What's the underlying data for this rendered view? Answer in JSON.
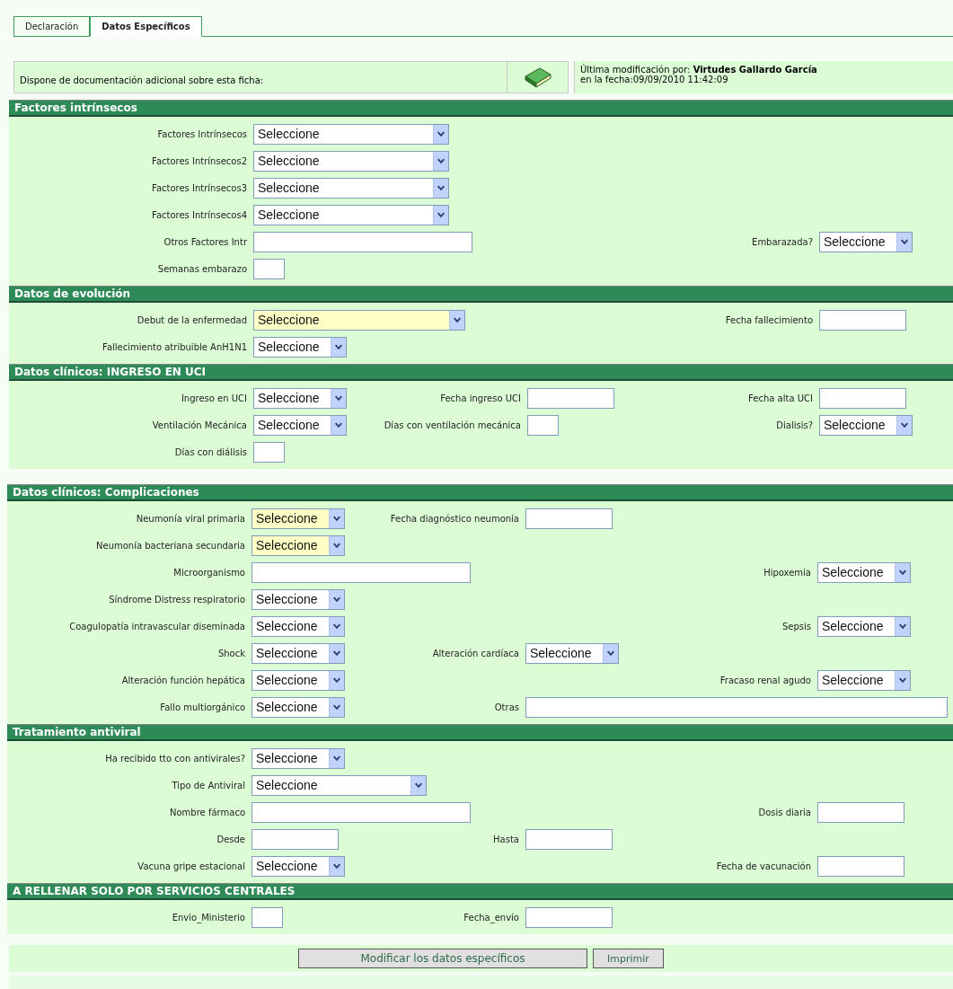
{
  "tabs": [
    {
      "label": "Declaración",
      "selected": false
    },
    {
      "label": "Datos Específicos",
      "selected": true
    }
  ],
  "info_bar": {
    "documentation_text": "Dispone de documentación adicional sobre esta ficha:",
    "modified_by": "Última modificación por: **Virtudes Gallardo García**",
    "modified_date": "en la fecha:09/09/2010 11:42:09"
  },
  "panels": [
    {
      "sections": [
        {
          "title": "Factores intrínsecos",
          "rows": [
            {
              "left": {
                "label": "Factores Intrínsecos",
                "kind": "selectwide",
                "value": "Seleccione",
                "highlighted": false
              }
            },
            {
              "left": {
                "label": "Factores Intrínsecos2",
                "kind": "selectwide",
                "value": "Seleccione",
                "highlighted": false
              }
            },
            {
              "left": {
                "label": "Factores Intrínsecos3",
                "kind": "selectwide",
                "value": "Seleccione",
                "highlighted": false
              }
            },
            {
              "left": {
                "label": "Factores Intrínsecos4",
                "kind": "selectwide",
                "value": "Seleccione",
                "highlighted": false
              }
            },
            {
              "left": {
                "label": "Otros Factores Intr",
                "kind": "text"
              },
              "right": {
                "label": "Embarazada?",
                "kind": "select",
                "value": "Seleccione",
                "highlighted": false
              }
            },
            {
              "left": {
                "label": "Semanas embarazo",
                "kind": "tiny"
              }
            }
          ]
        },
        {
          "title": "Datos de evolución",
          "rows": [
            {
              "left": {
                "label": "Debut de la enfermedad",
                "kind": "selectlong",
                "value": "Seleccione",
                "highlighted": true
              },
              "right": {
                "label": "Fecha fallecimiento",
                "kind": "date"
              }
            },
            {
              "left": {
                "label": "Fallecimiento atribuible AnH1N1",
                "kind": "select",
                "value": "Seleccione",
                "highlighted": false
              }
            }
          ]
        },
        {
          "title": "Datos clínicos: INGRESO EN UCI",
          "rows": [
            {
              "left": {
                "label": "Ingreso en UCI",
                "kind": "select",
                "value": "Seleccione",
                "highlighted": false
              },
              "middle": {
                "label": "Fecha ingreso UCI",
                "kind": "date"
              },
              "right": {
                "label": "Fecha alta UCI",
                "kind": "date"
              }
            },
            {
              "left": {
                "label": "Ventilación Mecánica",
                "kind": "select",
                "value": "Seleccione",
                "highlighted": false
              },
              "middle": {
                "label": "Días con ventilación mecánica",
                "kind": "tiny"
              },
              "right": {
                "label": "Dialisis?",
                "kind": "select",
                "value": "Seleccione",
                "highlighted": false
              }
            },
            {
              "left": {
                "label": "Días con diálisis",
                "kind": "tiny"
              }
            }
          ]
        }
      ]
    },
    {
      "sections": [
        {
          "title": "Datos clínicos: Complicaciones",
          "rows": [
            {
              "left": {
                "label": "Neumonía viral primaria",
                "kind": "select",
                "value": "Seleccione",
                "highlighted": true
              },
              "middle": {
                "label": "Fecha diagnóstico neumonía",
                "kind": "date"
              }
            },
            {
              "left": {
                "label": "Neumonía bacteriana secundaria",
                "kind": "select",
                "value": "Seleccione",
                "highlighted": true
              }
            },
            {
              "left": {
                "label": "Microorganismo",
                "kind": "text"
              },
              "right": {
                "label": "Hipoxemia",
                "kind": "select",
                "value": "Seleccione",
                "highlighted": false
              }
            },
            {
              "left": {
                "label": "Síndrome Distress respiratorio",
                "kind": "select",
                "value": "Seleccione",
                "highlighted": false
              }
            },
            {
              "left": {
                "label": "Coagulopatía intravascular diseminada",
                "kind": "select",
                "value": "Seleccione",
                "highlighted": false
              },
              "right": {
                "label": "Sepsis",
                "kind": "select",
                "value": "Seleccione",
                "highlighted": false
              }
            },
            {
              "left": {
                "label": "Shock",
                "kind": "select",
                "value": "Seleccione",
                "highlighted": false
              },
              "middle": {
                "label": "Alteración cardíaca",
                "kind": "select",
                "value": "Seleccione",
                "highlighted": false
              }
            },
            {
              "left": {
                "label": "Alteración función hepática",
                "kind": "select",
                "value": "Seleccione",
                "highlighted": false
              },
              "right": {
                "label": "Fracaso renal agudo",
                "kind": "select",
                "value": "Seleccione",
                "highlighted": false
              }
            },
            {
              "left": {
                "label": "Fallo multiorgánico",
                "kind": "select",
                "value": "Seleccione",
                "highlighted": false
              },
              "middle": {
                "label": "Otras",
                "kind": "textfull"
              }
            }
          ]
        },
        {
          "title": "Tratamiento antiviral",
          "rows": [
            {
              "left": {
                "label": "Ha recibido tto con antivirales?",
                "kind": "select",
                "value": "Seleccione",
                "highlighted": false
              }
            },
            {
              "left": {
                "label": "Tipo de Antiviral",
                "kind": "selectmedium",
                "value": "Seleccione",
                "highlighted": false
              }
            },
            {
              "left": {
                "label": "Nombre fármaco",
                "kind": "text"
              },
              "right": {
                "label": "Dosis diaria",
                "kind": "date"
              }
            },
            {
              "left": {
                "label": "Desde",
                "kind": "date"
              },
              "middle": {
                "label": "Hasta",
                "kind": "date"
              }
            },
            {
              "left": {
                "label": "Vacuna gripe estacional",
                "kind": "select",
                "value": "Seleccione",
                "highlighted": false
              },
              "right": {
                "label": "Fecha de vacunación",
                "kind": "date"
              }
            }
          ]
        },
        {
          "title": "A RELLENAR SOLO POR SERVICIOS CENTRALES",
          "rows": [
            {
              "left": {
                "label": "Envio_Ministerio",
                "kind": "tiny"
              },
              "middle": {
                "label": "Fecha_envío",
                "kind": "date"
              }
            }
          ]
        }
      ]
    }
  ],
  "buttons": [
    {
      "label": "Modificar los datos específicos",
      "kind": "primary"
    },
    {
      "label": "Imprimir",
      "kind": "secondary"
    }
  ]
}
